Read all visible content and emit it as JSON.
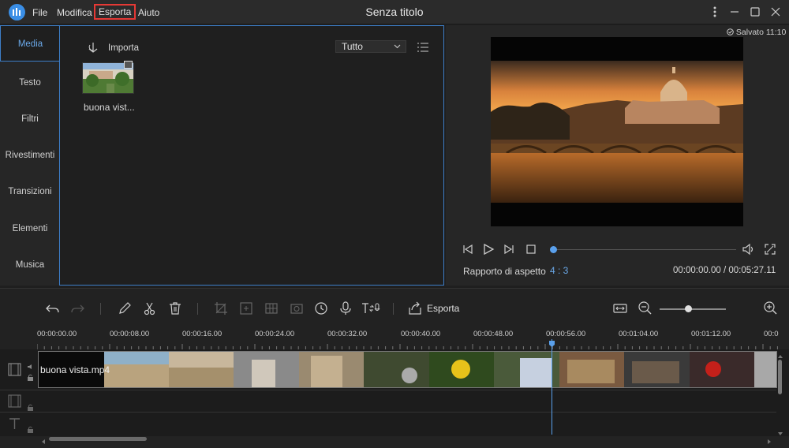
{
  "app": {
    "title": "Senza titolo",
    "menu": [
      "File",
      "Modifica",
      "Esporta",
      "Aiuto"
    ]
  },
  "left_tabs": [
    "Media",
    "Testo",
    "Filtri",
    "Rivestimenti",
    "Transizioni",
    "Elementi",
    "Musica"
  ],
  "media": {
    "import_label": "Importa",
    "filter_value": "Tutto",
    "items": [
      {
        "name": "buona vist..."
      }
    ]
  },
  "preview": {
    "saved_status": "Salvato 11:10",
    "aspect_label": "Rapporto di aspetto",
    "aspect_value": "4 : 3",
    "timecode": "00:00:00.00 / 00:05:27.11",
    "progress": 0.0
  },
  "toolbar": {
    "export_label": "Esporta",
    "zoom_level": 0.45
  },
  "timeline": {
    "ruler_labels": [
      "00:00:00.00",
      "00:00:08.00",
      "00:00:16.00",
      "00:00:24.00",
      "00:00:32.00",
      "00:00:40.00",
      "00:00:48.00",
      "00:00:56.00",
      "00:01:04.00",
      "00:01:12.00",
      "00:0"
    ],
    "clip_name": "buona vista.mp4",
    "playhead_time": "00:00:56.00"
  },
  "colors": {
    "accent": "#3d7ec8",
    "highlight": "#e53935",
    "bg": "#1f1f1f"
  }
}
